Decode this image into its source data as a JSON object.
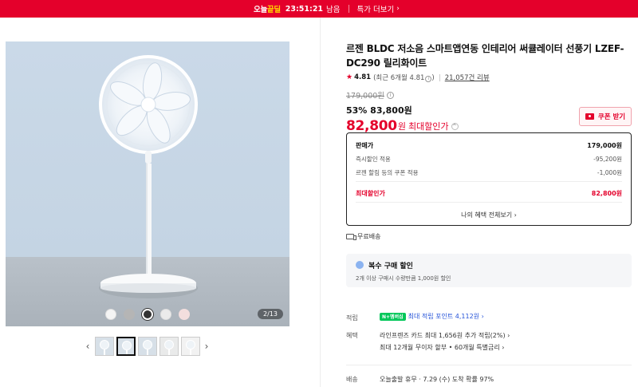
{
  "banner": {
    "deal_prefix": "오늘",
    "deal_highlight": "끝딜",
    "timer": "23:51:21",
    "remaining": "남음",
    "more_link": "특가 더보기",
    "color": "#e4002b"
  },
  "gallery": {
    "page_indicator": "2/13",
    "swatch_colors": [
      "#f4f4f4",
      "#b5b5b5",
      "#333333",
      "#ebebeb",
      "#f3dede"
    ],
    "thumbnail_count": 5,
    "active_thumbnail": 2
  },
  "product": {
    "title": "르젠 BLDC 저소음 스마트앱연동 인테리어 써큘레이터 선풍기 LZEF-DC290 릴리화이트",
    "rating_score": "4.81",
    "rating_recent": "(최근 6개월 4.81",
    "rating_recent_close": ")",
    "review_count": "21,057건 리뷰",
    "original_price": "179,000원",
    "discount_line": "53% 83,800원",
    "final_price": "82,800",
    "final_won": "원",
    "final_label": "최대할인가",
    "coupon_button": "쿠폰 받기"
  },
  "price_box": {
    "rows": [
      {
        "label": "판매가",
        "value": "179,000원"
      },
      {
        "label": "즉시할인 적용",
        "value": "-95,200원"
      },
      {
        "label": "르젠 할림 등의 쿠폰 적용",
        "value": "-1,000원"
      },
      {
        "label": "최대할인가",
        "value": "82,800원"
      }
    ],
    "benefit_link": "나의 혜택 전체보기"
  },
  "shipping": {
    "label": "무료배송"
  },
  "multibuy": {
    "title": "복수 구매 할인",
    "desc": "2개 이상 구매시 수량만큼 1,000원 할인"
  },
  "details": {
    "points_label": "적립",
    "points_badge": "N+멤버십",
    "points_text": "최대 적립 포인트 4,112원",
    "benefit_label": "혜택",
    "benefit_line1": "라인프렌즈 카드 최대 1,656원 추가 적립(2%)",
    "benefit_line2": "최대 12개월 무이자 할부 • 60개월 특별금리",
    "delivery_label": "배송",
    "delivery_text": "오늘출발 휴무 · 7.29 (수) 도착 확률 97%"
  },
  "colors": {
    "accent_red": "#e4002b",
    "link_blue": "#2553d8"
  }
}
